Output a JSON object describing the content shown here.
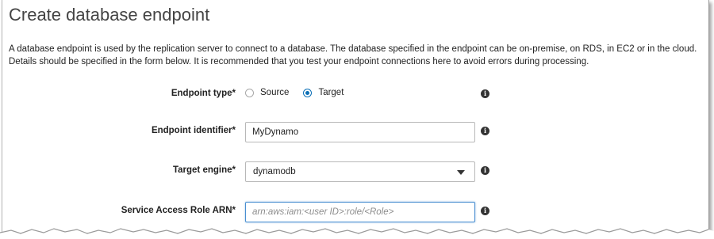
{
  "page": {
    "title": "Create database endpoint",
    "description": "A database endpoint is used by the replication server to connect to a database. The database specified in the endpoint can be on-premise, on RDS, in EC2 or in the cloud. Details should be specified in the form below. It is recommended that you test your endpoint connections here to avoid errors during processing."
  },
  "form": {
    "endpoint_type": {
      "label": "Endpoint type",
      "required_mark": "*",
      "options": [
        {
          "label": "Source",
          "selected": false
        },
        {
          "label": "Target",
          "selected": true
        }
      ]
    },
    "endpoint_identifier": {
      "label": "Endpoint identifier",
      "required_mark": "*",
      "value": "MyDynamo"
    },
    "target_engine": {
      "label": "Target engine",
      "required_mark": "*",
      "value": "dynamodb"
    },
    "service_access_role_arn": {
      "label": "Service Access Role ARN",
      "required_mark": "*",
      "value": "",
      "placeholder": "arn:aws:iam:<user ID>:role/<Role>"
    }
  },
  "icons": {
    "info": "info-icon",
    "dropdown": "chevron-down-icon"
  },
  "colors": {
    "radio_selected": "#0b6fb6",
    "focus_border": "#4a8fd1",
    "title_text": "#444444"
  }
}
